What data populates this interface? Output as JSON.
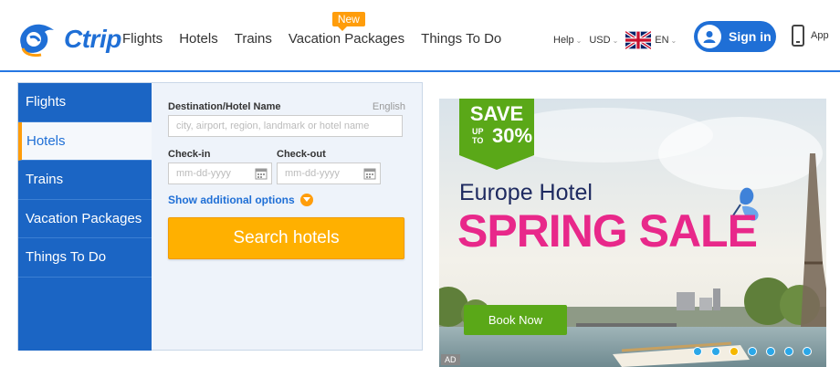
{
  "header": {
    "logo_text": "Ctrip",
    "nav": [
      {
        "label": "Flights"
      },
      {
        "label": "Hotels"
      },
      {
        "label": "Trains"
      },
      {
        "label": "Vacation Packages",
        "badge": "New"
      },
      {
        "label": "Things To Do"
      }
    ],
    "help": "Help",
    "currency": "USD",
    "language": "EN",
    "sign_in": "Sign in",
    "app": "App"
  },
  "search": {
    "tabs": [
      "Flights",
      "Hotels",
      "Trains",
      "Vacation Packages",
      "Things To Do"
    ],
    "active_tab": "Hotels",
    "destination_label": "Destination/Hotel Name",
    "destination_lang": "English",
    "destination_placeholder": "city, airport, region, landmark or hotel name",
    "checkin_label": "Check-in",
    "checkin_placeholder": "mm-dd-yyyy",
    "checkout_label": "Check-out",
    "checkout_placeholder": "mm-dd-yyyy",
    "additional_options": "Show additional options",
    "search_button": "Search hotels"
  },
  "ad": {
    "save_line1": "SAVE",
    "save_line2a": "UP",
    "save_line2b": "TO",
    "save_percent": "30%",
    "title": "Europe Hotel",
    "headline": "SPRING SALE",
    "cta": "Book Now",
    "tag": "AD",
    "carousel_count": 7,
    "carousel_active": 3
  },
  "colors": {
    "brand_blue": "#1f6fd6",
    "accent_orange": "#ffb000",
    "sale_pink": "#e8288a",
    "save_green": "#5aa818"
  }
}
